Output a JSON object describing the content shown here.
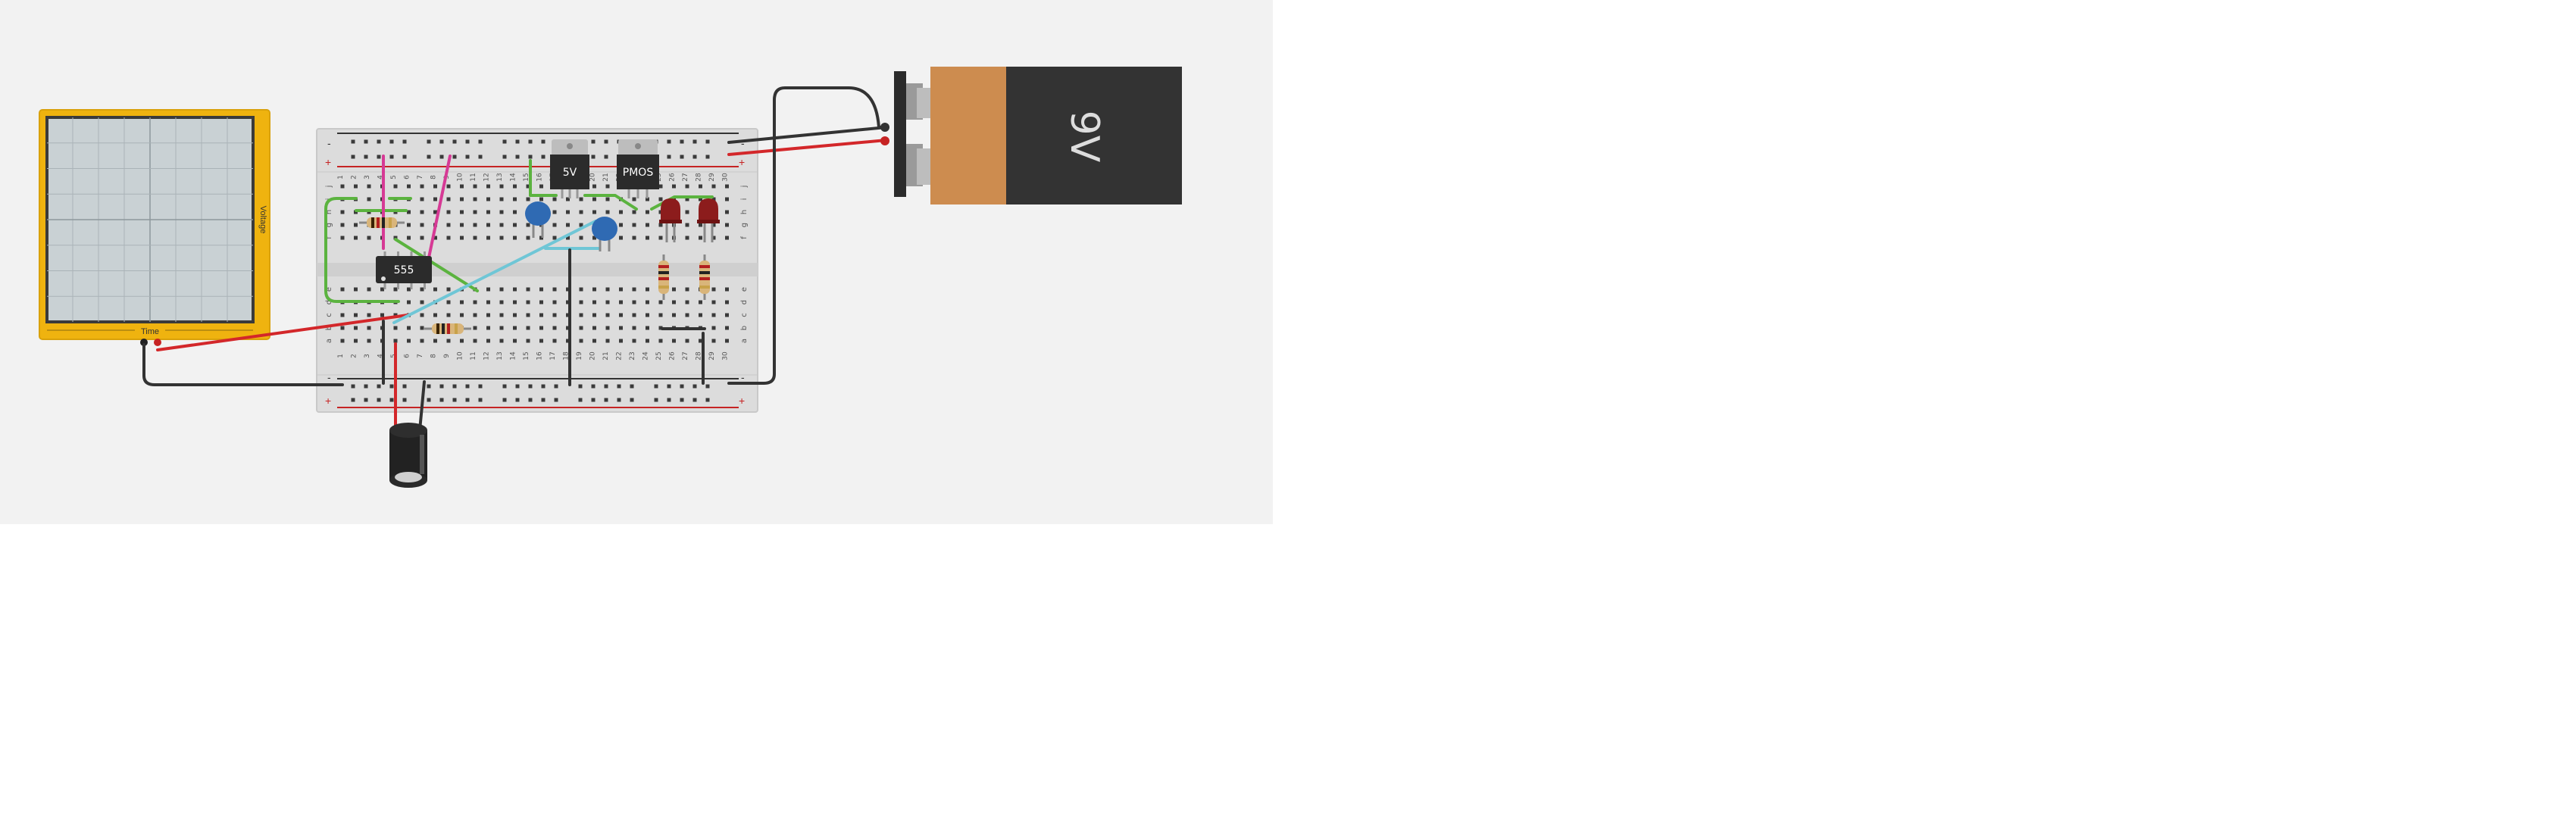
{
  "oscilloscope": {
    "y_axis_label": "Voltage",
    "x_axis_label": "Time"
  },
  "breadboard": {
    "columns": [
      "1",
      "2",
      "3",
      "4",
      "5",
      "6",
      "7",
      "8",
      "9",
      "10",
      "11",
      "12",
      "13",
      "14",
      "15",
      "16",
      "17",
      "18",
      "19",
      "20",
      "21",
      "22",
      "23",
      "24",
      "25",
      "26",
      "27",
      "28",
      "29",
      "30"
    ],
    "rows_top": [
      "j",
      "i",
      "h",
      "g",
      "f"
    ],
    "rows_bottom": [
      "e",
      "d",
      "c",
      "b",
      "a"
    ],
    "rail_minus": "-",
    "rail_plus": "+"
  },
  "components": {
    "timer_ic_label": "555",
    "regulator_label": "5V",
    "pmos_label": "PMOS",
    "battery_label": "9V"
  },
  "colors": {
    "canvas_bg": "#f2f2f2",
    "scope_frame": "#efb30f",
    "scope_screen": "#c9d1d4",
    "breadboard": "#dcdcdc",
    "wire_red": "#d3272a",
    "wire_black": "#333333",
    "wire_green": "#5bb33f",
    "wire_magenta": "#d63a95",
    "wire_cyan": "#6fc6d6",
    "capacitor_blue": "#2f6ab3",
    "led_red": "#8c1c1c",
    "battery_copper": "#cd8c4f",
    "battery_body": "#333333"
  }
}
